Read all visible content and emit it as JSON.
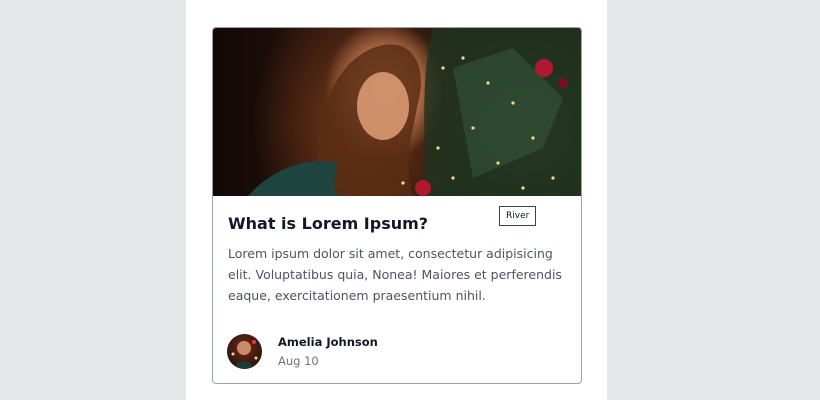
{
  "card": {
    "image_alt": "girl-decorating-christmas-tree-photo",
    "title": "What is Lorem Ipsum?",
    "tag": "River",
    "description": "Lorem ipsum dolor sit amet, consectetur adipisicing elit. Voluptatibus quia, Nonea! Maiores et perferendis eaque, exercitationem praesentium nihil.",
    "author": {
      "name": "Amelia Johnson",
      "date": "Aug 10"
    }
  },
  "colors": {
    "background": "#e5e7eb",
    "page": "#ffffff",
    "title": "#111827",
    "text": "#4b5563",
    "border": "#9ca3af"
  }
}
